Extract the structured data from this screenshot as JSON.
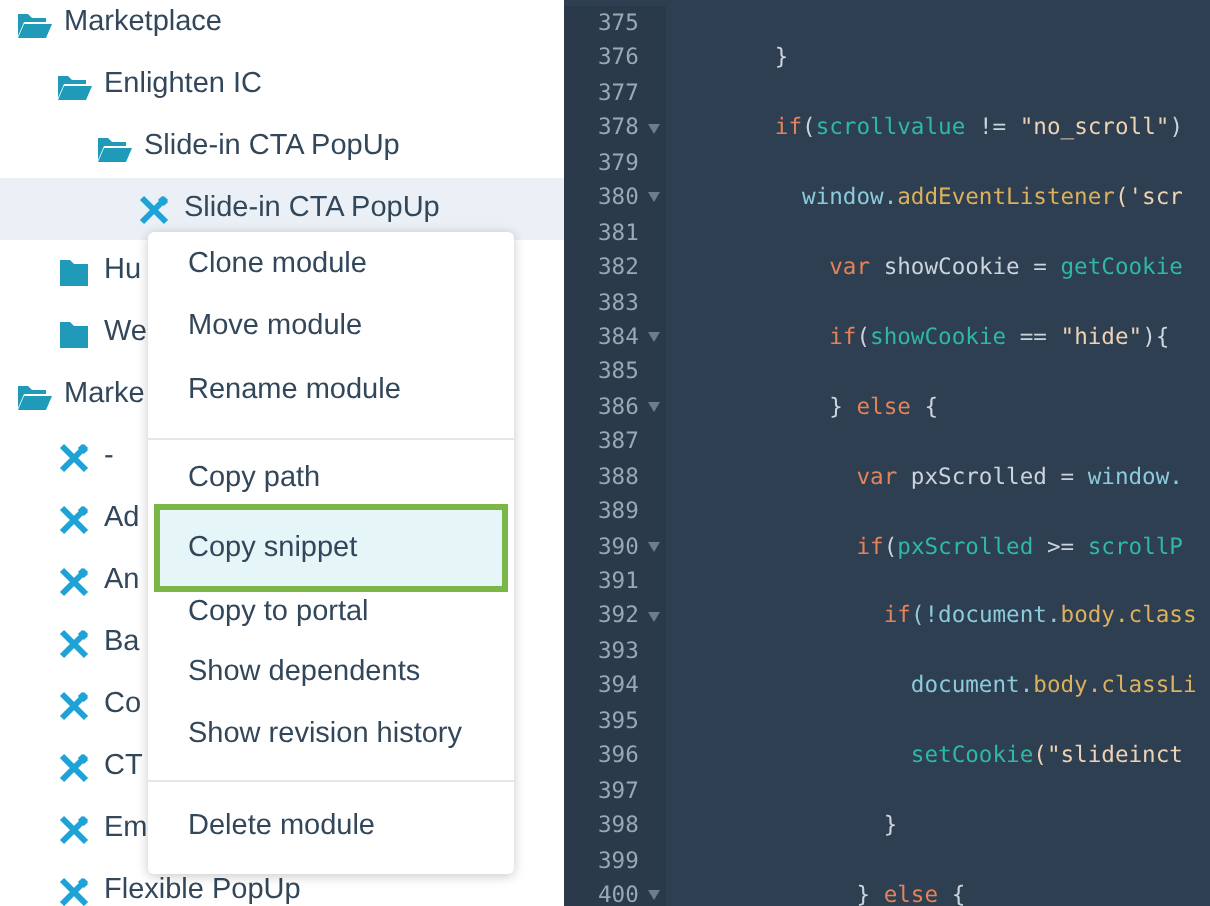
{
  "tree": [
    {
      "kind": "folder",
      "label": "Marketplace",
      "expanded": true,
      "selected": false,
      "children": [
        {
          "kind": "folder",
          "label": "Enlighten IC",
          "expanded": true,
          "selected": false,
          "children": [
            {
              "kind": "folder",
              "label": "Slide-in CTA PopUp",
              "expanded": true,
              "selected": false,
              "children": [
                {
                  "kind": "module",
                  "label": "Slide-in CTA PopUp",
                  "selected": true
                }
              ]
            }
          ]
        },
        {
          "kind": "folder",
          "label": "Hu",
          "expanded": false,
          "selected": false
        },
        {
          "kind": "folder",
          "label": "We",
          "expanded": false,
          "selected": false
        }
      ]
    },
    {
      "kind": "folder",
      "label": "Marke",
      "expanded": true,
      "selected": false,
      "children": [
        {
          "kind": "module",
          "label": "-",
          "selected": false
        },
        {
          "kind": "module",
          "label": "Ad",
          "selected": false
        },
        {
          "kind": "module",
          "label": "An",
          "selected": false
        },
        {
          "kind": "module",
          "label": "Ba",
          "selected": false
        },
        {
          "kind": "module",
          "label": "Co",
          "selected": false
        },
        {
          "kind": "module",
          "label": "CT",
          "selected": false
        },
        {
          "kind": "module",
          "label": "Em",
          "selected": false
        },
        {
          "kind": "module",
          "label": "Flexible PopUp",
          "selected": false
        }
      ]
    }
  ],
  "context_menu": {
    "groups": [
      [
        {
          "label": "Clone module",
          "selected": false
        },
        {
          "label": "Move module",
          "selected": false
        },
        {
          "label": "Rename module",
          "selected": false
        }
      ],
      [
        {
          "label": "Copy path",
          "selected": false
        },
        {
          "label": "Copy snippet",
          "selected": true
        },
        {
          "label": "Copy to portal",
          "selected": false
        },
        {
          "label": "Show dependents",
          "selected": false
        },
        {
          "label": "Show revision history",
          "selected": false
        }
      ],
      [
        {
          "label": "Delete module",
          "selected": false
        }
      ]
    ]
  },
  "editor": {
    "lines": [
      {
        "number": "375",
        "foldable": false
      },
      {
        "number": "376",
        "foldable": false,
        "tokens": [
          {
            "kind": "punct",
            "text": "        }"
          }
        ]
      },
      {
        "number": "377",
        "foldable": false
      },
      {
        "number": "378",
        "foldable": true,
        "tokens": [
          {
            "kind": "keyword",
            "text": "        if"
          },
          {
            "kind": "punct",
            "text": "("
          },
          {
            "kind": "ident",
            "text": "scrollvalue"
          },
          {
            "kind": "punct",
            "text": " != "
          },
          {
            "kind": "string",
            "text": "\"no_scroll\""
          },
          {
            "kind": "punct",
            "text": ")"
          }
        ]
      },
      {
        "number": "379",
        "foldable": false
      },
      {
        "number": "380",
        "foldable": true,
        "tokens": [
          {
            "kind": "object",
            "text": "          window."
          },
          {
            "kind": "method",
            "text": "addEventListener"
          },
          {
            "kind": "string",
            "text": "('scr"
          }
        ]
      },
      {
        "number": "381",
        "foldable": false
      },
      {
        "number": "382",
        "foldable": false,
        "tokens": [
          {
            "kind": "keyword",
            "text": "            var"
          },
          {
            "kind": "punct",
            "text": " showCookie = "
          },
          {
            "kind": "ident",
            "text": "getCookie"
          }
        ]
      },
      {
        "number": "383",
        "foldable": false
      },
      {
        "number": "384",
        "foldable": true,
        "tokens": [
          {
            "kind": "keyword",
            "text": "            if"
          },
          {
            "kind": "punct",
            "text": "("
          },
          {
            "kind": "ident",
            "text": "showCookie"
          },
          {
            "kind": "punct",
            "text": " == "
          },
          {
            "kind": "string",
            "text": "\"hide\""
          },
          {
            "kind": "punct",
            "text": "){"
          }
        ]
      },
      {
        "number": "385",
        "foldable": false
      },
      {
        "number": "386",
        "foldable": true,
        "tokens": [
          {
            "kind": "punct",
            "text": "            } "
          },
          {
            "kind": "keyword",
            "text": "else"
          },
          {
            "kind": "punct",
            "text": " {"
          }
        ]
      },
      {
        "number": "387",
        "foldable": false
      },
      {
        "number": "388",
        "foldable": false,
        "tokens": [
          {
            "kind": "keyword",
            "text": "              var"
          },
          {
            "kind": "punct",
            "text": " pxScrolled = "
          },
          {
            "kind": "object",
            "text": "window."
          }
        ]
      },
      {
        "number": "389",
        "foldable": false
      },
      {
        "number": "390",
        "foldable": true,
        "tokens": [
          {
            "kind": "keyword",
            "text": "              if"
          },
          {
            "kind": "punct",
            "text": "("
          },
          {
            "kind": "ident",
            "text": "pxScrolled"
          },
          {
            "kind": "punct",
            "text": " >= "
          },
          {
            "kind": "ident",
            "text": "scrollP"
          }
        ]
      },
      {
        "number": "391",
        "foldable": false
      },
      {
        "number": "392",
        "foldable": true,
        "tokens": [
          {
            "kind": "keyword",
            "text": "                if"
          },
          {
            "kind": "object",
            "text": "(!document."
          },
          {
            "kind": "method",
            "text": "body.class"
          }
        ]
      },
      {
        "number": "393",
        "foldable": false
      },
      {
        "number": "394",
        "foldable": false,
        "tokens": [
          {
            "kind": "object",
            "text": "                  document."
          },
          {
            "kind": "method",
            "text": "body.classLi"
          }
        ]
      },
      {
        "number": "395",
        "foldable": false
      },
      {
        "number": "396",
        "foldable": false,
        "tokens": [
          {
            "kind": "ident",
            "text": "                  setCookie"
          },
          {
            "kind": "string",
            "text": "(\"slideinct"
          }
        ]
      },
      {
        "number": "397",
        "foldable": false
      },
      {
        "number": "398",
        "foldable": false,
        "tokens": [
          {
            "kind": "punct",
            "text": "                }"
          }
        ]
      },
      {
        "number": "399",
        "foldable": false
      },
      {
        "number": "400",
        "foldable": true,
        "tokens": [
          {
            "kind": "punct",
            "text": "              } "
          },
          {
            "kind": "keyword",
            "text": "else"
          },
          {
            "kind": "punct",
            "text": " {"
          }
        ]
      }
    ]
  }
}
